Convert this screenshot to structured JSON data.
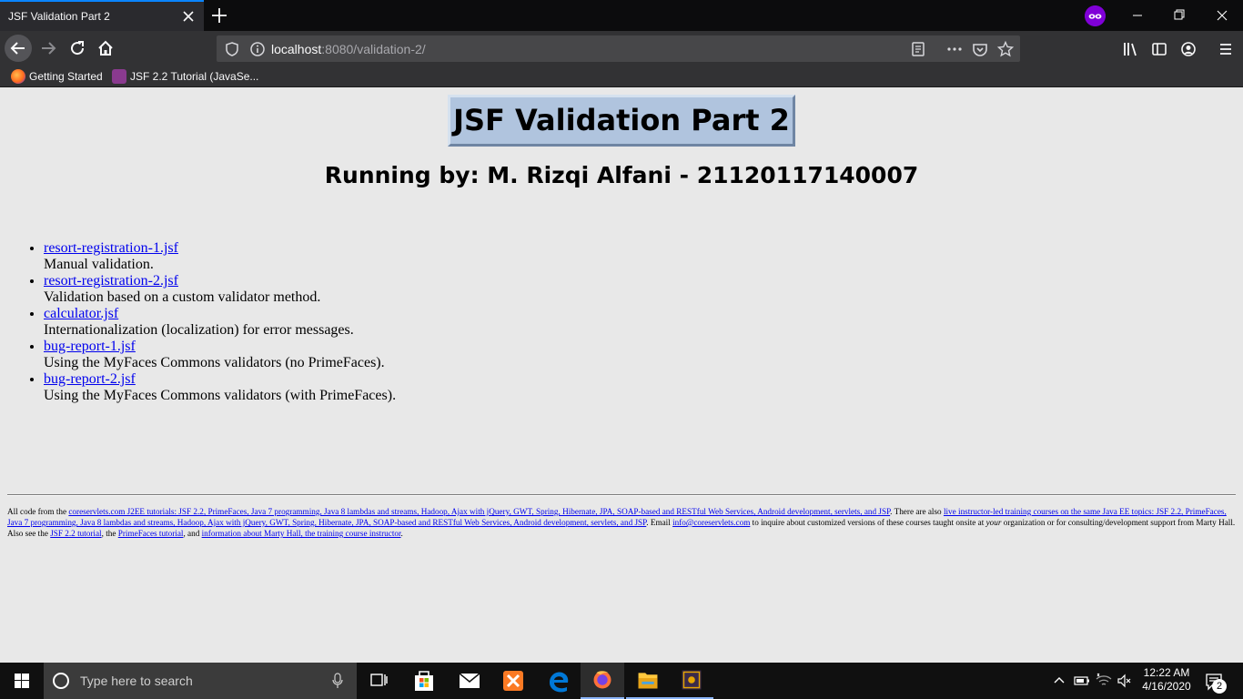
{
  "browser": {
    "tab_title": "JSF Validation Part 2",
    "url_host": "localhost",
    "url_rest": ":8080/validation-2/",
    "bookmarks": [
      "Getting Started",
      "JSF 2.2 Tutorial (JavaSe..."
    ]
  },
  "page": {
    "title": "JSF Validation Part 2",
    "subtitle": "Running by: M. Rizqi Alfani - 21120117140007",
    "items": [
      {
        "link": "resort-registration-1.jsf",
        "desc": "Manual validation."
      },
      {
        "link": "resort-registration-2.jsf",
        "desc": "Validation based on a custom validator method."
      },
      {
        "link": "calculator.jsf",
        "desc": "Internationalization (localization) for error messages."
      },
      {
        "link": "bug-report-1.jsf",
        "desc": "Using the MyFaces Commons validators (no PrimeFaces)."
      },
      {
        "link": "bug-report-2.jsf",
        "desc": "Using the MyFaces Commons validators (with PrimeFaces)."
      }
    ],
    "footer": {
      "t1": "All code from the ",
      "l1": "coreservlets.com J2EE tutorials: JSF 2.2, PrimeFaces, Java 7 programming, Java 8 lambdas and streams, Hadoop, Ajax with jQuery, GWT, Spring, Hibernate, JPA, SOAP-based and RESTful Web Services, Android development, servlets, and JSP",
      "t2": ". There are also ",
      "l2": "live instructor-led training courses on the same Java EE topics: JSF 2.2, PrimeFaces, Java 7 programming, Java 8 lambdas and streams, Hadoop, Ajax with jQuery, GWT, Spring, Hibernate, JPA, SOAP-based and RESTful Web Services, Android development, servlets, and JSP",
      "t3": ". Email ",
      "l3": "info@coreservlets.com",
      "t4": " to inquire about customized versions of these courses taught onsite at ",
      "em": "your",
      "t5": " organization or for consulting/development support from Marty Hall. Also see the ",
      "l4": "JSF 2.2 tutorial",
      "t6": ", the ",
      "l5": "PrimeFaces tutorial",
      "t7": ", and ",
      "l6": "information about Marty Hall, the training course instructor",
      "t8": "."
    }
  },
  "taskbar": {
    "search_placeholder": "Type here to search",
    "time": "12:22 AM",
    "date": "4/16/2020",
    "notification_count": "2"
  },
  "icons": {
    "accent": "#0a84ff",
    "private": "#8000d7",
    "title_box": "#b0c4de",
    "link": "#0000ee"
  }
}
